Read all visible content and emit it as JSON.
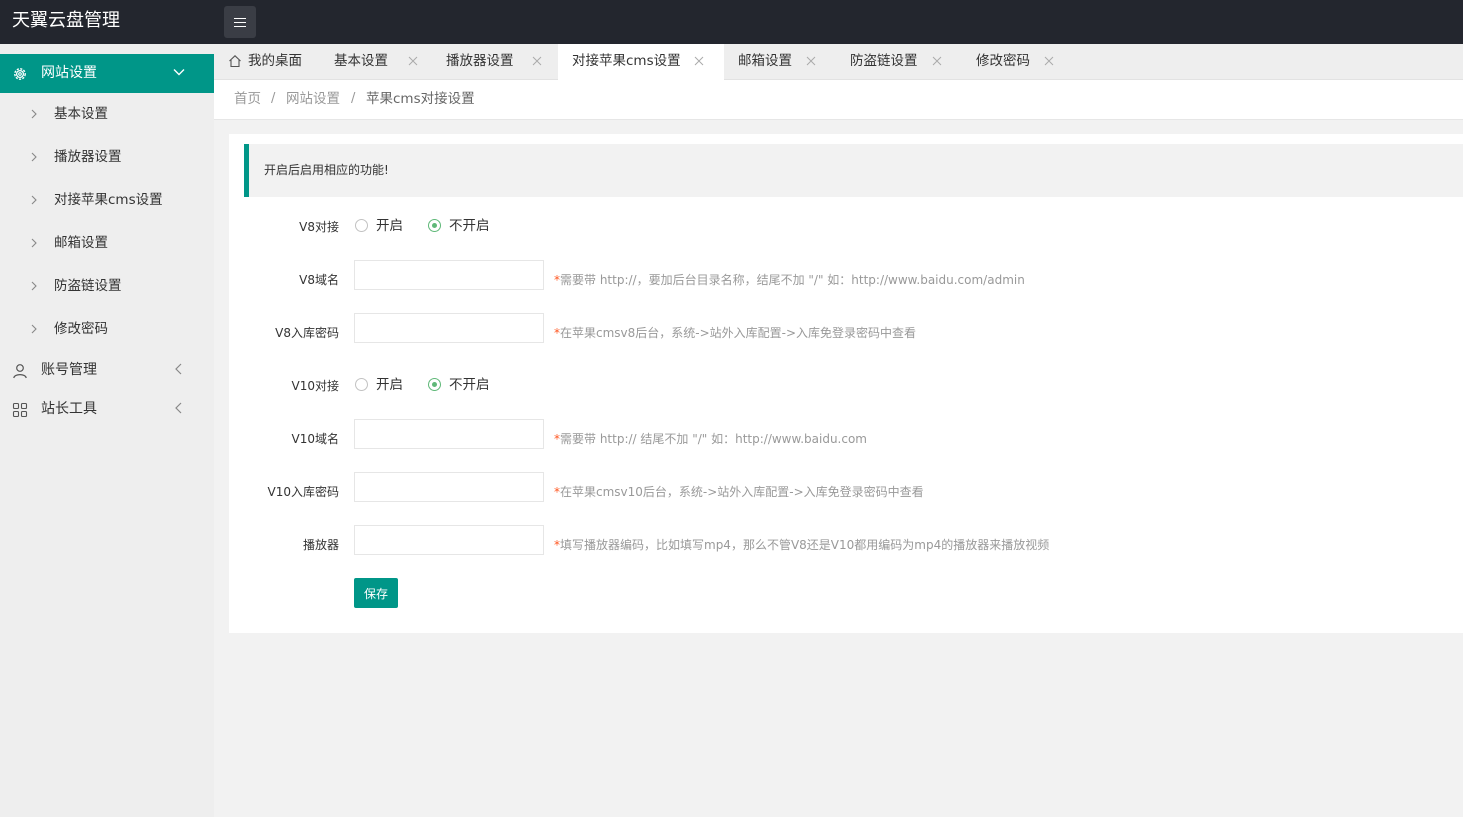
{
  "app": {
    "title": "天翼云盘管理"
  },
  "sidebar": {
    "groups": [
      {
        "label": "网站设置",
        "icon": "gear-icon",
        "expanded": true
      },
      {
        "label": "账号管理",
        "icon": "user-icon",
        "expanded": false
      },
      {
        "label": "站长工具",
        "icon": "grid-icon",
        "expanded": false
      }
    ],
    "items": [
      {
        "label": "基本设置"
      },
      {
        "label": "播放器设置"
      },
      {
        "label": "对接苹果cms设置"
      },
      {
        "label": "邮箱设置"
      },
      {
        "label": "防盗链设置"
      },
      {
        "label": "修改密码"
      }
    ]
  },
  "tabs": [
    {
      "label": "我的桌面",
      "icon": "home-icon"
    },
    {
      "label": "基本设置"
    },
    {
      "label": "播放器设置"
    },
    {
      "label": "对接苹果cms设置",
      "active": true
    },
    {
      "label": "邮箱设置"
    },
    {
      "label": "防盗链设置"
    },
    {
      "label": "修改密码"
    }
  ],
  "breadcrumb": {
    "items": [
      "首页",
      "网站设置",
      "苹果cms对接设置"
    ],
    "separator": "/"
  },
  "notice": "开启后启用相应的功能!",
  "form": {
    "v8_connect": {
      "label": "V8对接",
      "options": [
        "开启",
        "不开启"
      ],
      "selected": "不开启"
    },
    "v8_domain": {
      "label": "V8域名",
      "value": "",
      "hint": "需要带 http://，要加后台目录名称，结尾不加 \"/\" 如：http://www.baidu.com/admin"
    },
    "v8_password": {
      "label": "V8入库密码",
      "value": "",
      "hint": "在苹果cmsv8后台，系统->站外入库配置->入库免登录密码中查看"
    },
    "v10_connect": {
      "label": "V10对接",
      "options": [
        "开启",
        "不开启"
      ],
      "selected": "不开启"
    },
    "v10_domain": {
      "label": "V10域名",
      "value": "",
      "hint": "需要带 http:// 结尾不加 \"/\" 如：http://www.baidu.com"
    },
    "v10_password": {
      "label": "V10入库密码",
      "value": "",
      "hint": "在苹果cmsv10后台，系统->站外入库配置->入库免登录密码中查看"
    },
    "player": {
      "label": "播放器",
      "value": "",
      "hint": "填写播放器编码，比如填写mp4，那么不管V8还是V10都用编码为mp4的播放器来播放视频"
    },
    "required_mark": "*",
    "save_label": "保存"
  },
  "colors": {
    "accent": "#009688",
    "header": "#23262e",
    "radio_checked": "#5fb878",
    "required": "#ff5722"
  }
}
